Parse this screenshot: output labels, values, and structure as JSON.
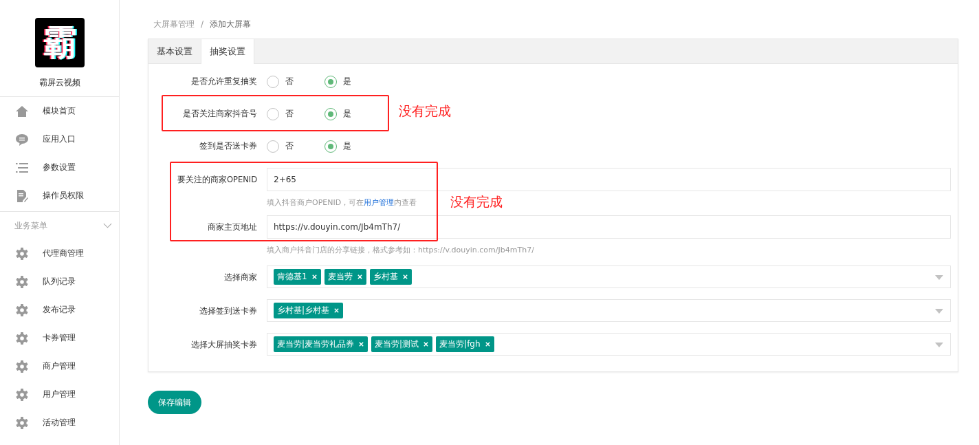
{
  "sidebar": {
    "logo_glyph": "霸",
    "brand": "霸屏云视频",
    "items": [
      {
        "kind": "home",
        "label": "模块首页"
      },
      {
        "kind": "chat",
        "label": "应用入口"
      },
      {
        "kind": "list",
        "label": "参数设置"
      },
      {
        "kind": "doc",
        "label": "操作员权限"
      }
    ],
    "section": {
      "title": "业务菜单",
      "expanded": true,
      "items": [
        {
          "kind": "gear",
          "label": "代理商管理"
        },
        {
          "kind": "gear",
          "label": "队列记录"
        },
        {
          "kind": "gear",
          "label": "发布记录"
        },
        {
          "kind": "gear",
          "label": "卡券管理"
        },
        {
          "kind": "gear",
          "label": "商户管理"
        },
        {
          "kind": "gear",
          "label": "用户管理"
        },
        {
          "kind": "gear",
          "label": "活动管理"
        }
      ]
    }
  },
  "breadcrumb": [
    "大屏幕管理",
    "添加大屏幕"
  ],
  "breadcrumb_separator": "/",
  "tabs": [
    {
      "label": "基本设置",
      "selected": false
    },
    {
      "label": "抽奖设置",
      "selected": true
    }
  ],
  "form": [
    {
      "kind": "radio",
      "label": "是否允许重复抽奖",
      "options": [
        {
          "label": "否",
          "selected": false
        },
        {
          "label": "是",
          "selected": true
        }
      ]
    },
    {
      "kind": "radio",
      "label": "是否关注商家抖音号",
      "options": [
        {
          "label": "否",
          "selected": false
        },
        {
          "label": "是",
          "selected": true
        }
      ]
    },
    {
      "kind": "radio",
      "label": "签到是否送卡券",
      "options": [
        {
          "label": "否",
          "selected": false
        },
        {
          "label": "是",
          "selected": true
        }
      ]
    },
    {
      "kind": "input",
      "label": "要关注的商家OPENID",
      "value": "2+65",
      "hint": {
        "before": "填入抖音商户OPENID，可在",
        "link": "用户管理",
        "after": "内查看"
      }
    },
    {
      "kind": "input",
      "label": "商家主页地址",
      "value": "https://v.douyin.com/Jb4mTh7/",
      "hint": {
        "before": "填入商户抖音门店的分享链接，格式参考如：https://v.douyin.com/Jb4mTh7/"
      }
    },
    {
      "kind": "select",
      "label": "选择商家",
      "tags": [
        "肯德基1",
        "麦当劳",
        "乡村基"
      ]
    },
    {
      "kind": "select",
      "label": "选择签到送卡券",
      "tags": [
        "乡村基|乡村基"
      ]
    },
    {
      "kind": "select",
      "label": "选择大屏抽奖卡券",
      "tags": [
        "麦当劳|麦当劳礼品券",
        "麦当劳|测试",
        "麦当劳|fgh"
      ]
    }
  ],
  "save_button": "保存编辑",
  "annotations": [
    {
      "note": "没有完成"
    },
    {
      "note": "没有完成"
    }
  ]
}
